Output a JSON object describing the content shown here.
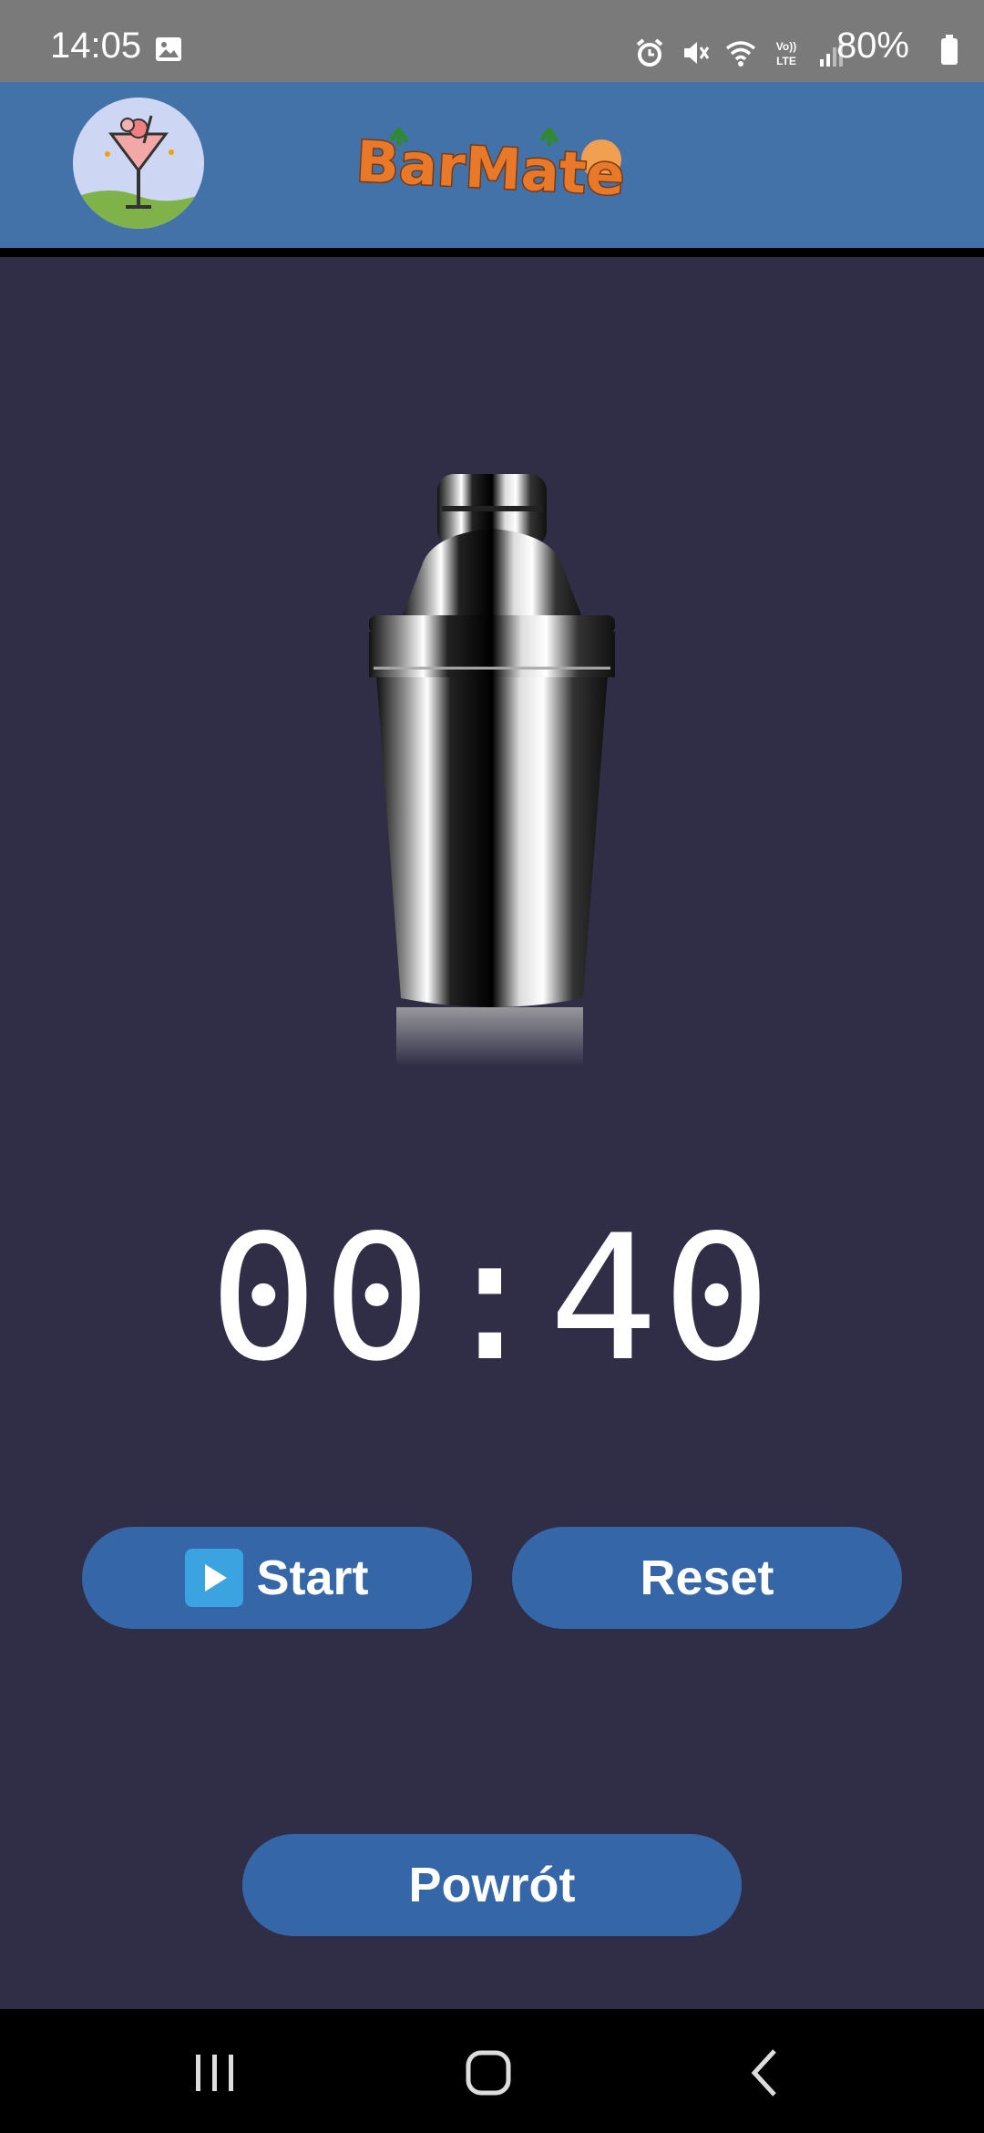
{
  "status_bar": {
    "time": "14:05",
    "battery": "80%",
    "icons": [
      "gallery-icon",
      "alarm-icon",
      "mute-icon",
      "wifi-icon",
      "volte-icon",
      "signal-icon",
      "battery-icon"
    ]
  },
  "header": {
    "logo_text": "BarMate",
    "avatar_icon": "cocktail-glass-icon"
  },
  "colors": {
    "background": "#302e46",
    "header": "#4372a9",
    "button": "#3566a8",
    "status_bar": "#7a7a7a"
  },
  "timer": {
    "display": "00:40"
  },
  "buttons": {
    "start_label": "Start",
    "reset_label": "Reset",
    "back_label": "Powrót"
  },
  "nav": {
    "items": [
      "recents-icon",
      "home-icon",
      "back-icon"
    ]
  }
}
